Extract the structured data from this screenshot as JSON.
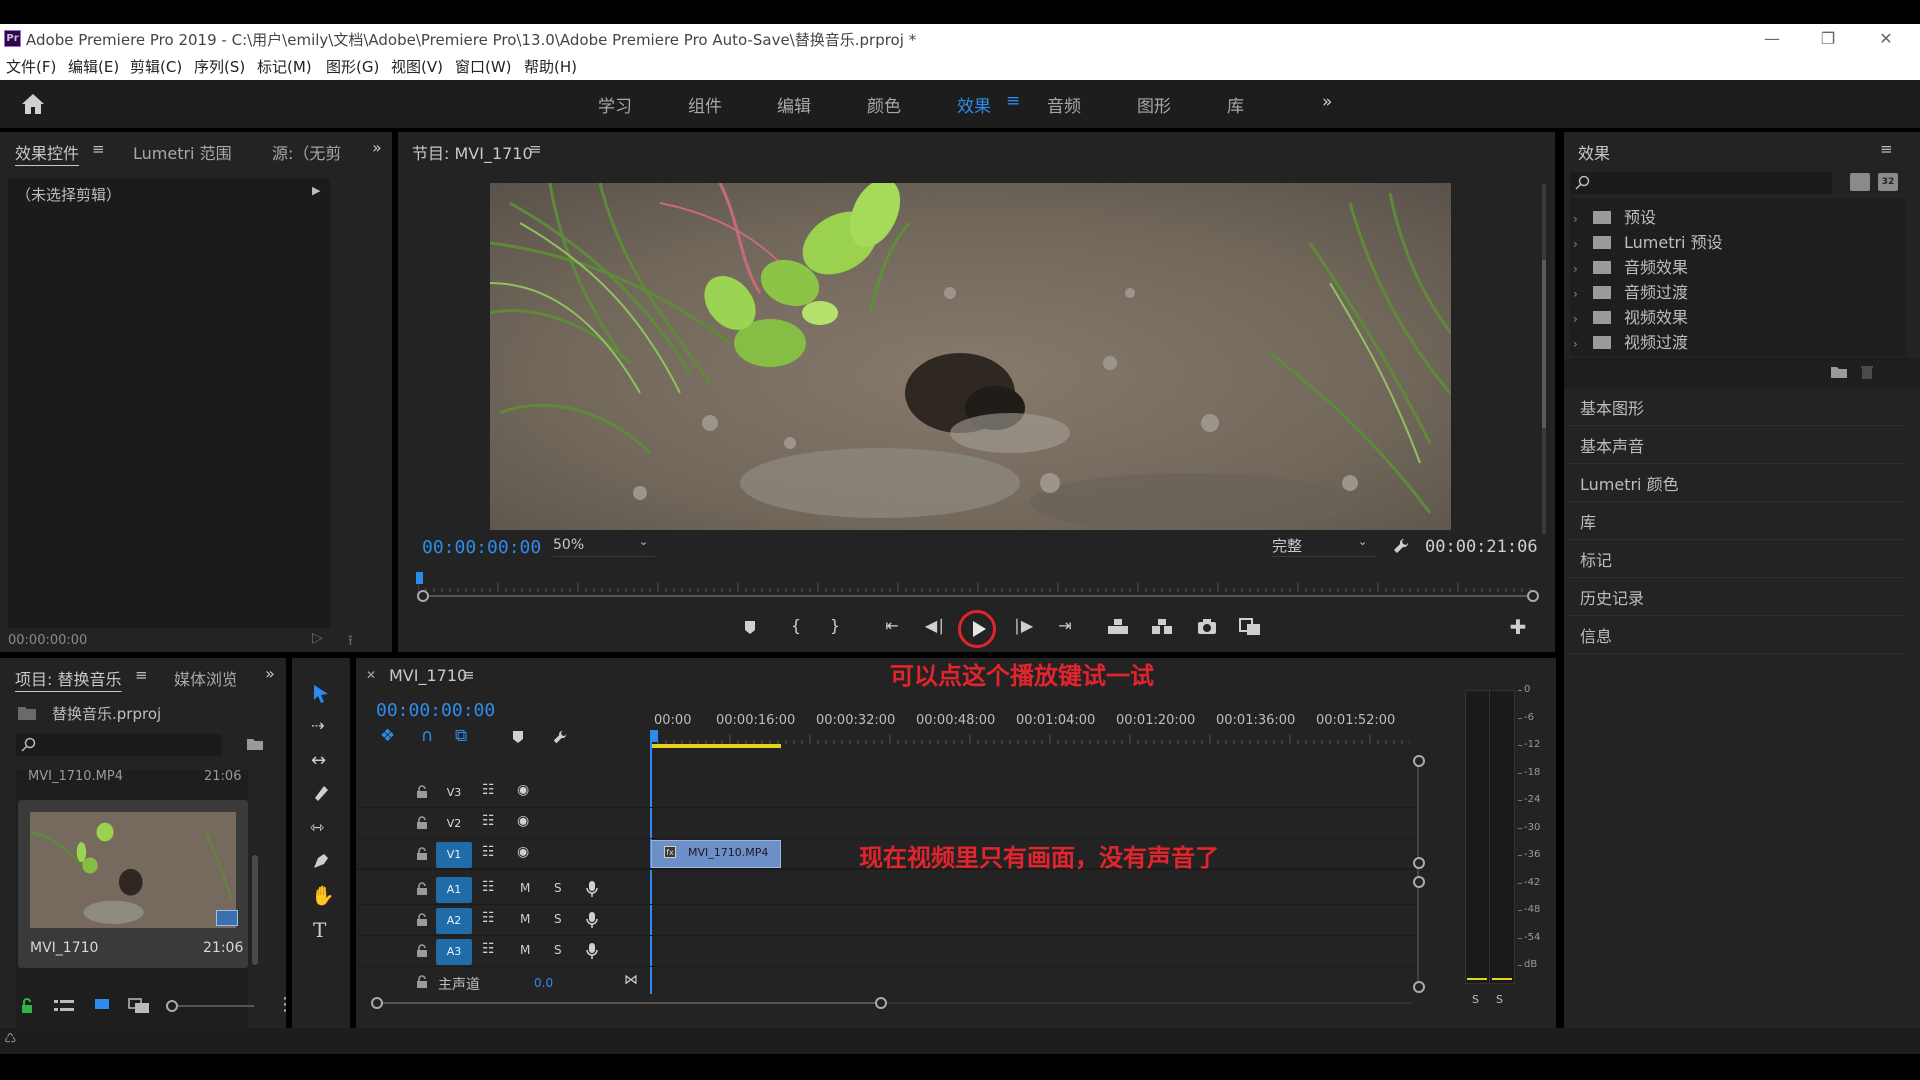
{
  "window": {
    "title": "Adobe Premiere Pro 2019 - C:\\用户\\emily\\文档\\Adobe\\Premiere Pro\\13.0\\Adobe Premiere Pro Auto-Save\\替换音乐.prproj *",
    "logo": "Pr"
  },
  "menu": [
    "文件(F)",
    "编辑(E)",
    "剪辑(C)",
    "序列(S)",
    "标记(M)",
    "图形(G)",
    "视图(V)",
    "窗口(W)",
    "帮助(H)"
  ],
  "workspaces": {
    "tabs": [
      "学习",
      "组件",
      "编辑",
      "颜色",
      "效果",
      "音频",
      "图形",
      "库"
    ],
    "active": "效果"
  },
  "effect_controls": {
    "tabs": [
      "效果控件",
      "Lumetri 范围",
      "源:（无剪"
    ],
    "no_clip": "（未选择剪辑）",
    "timecode": "00:00:00:00"
  },
  "program": {
    "title": "节目: MVI_1710",
    "timecode": "00:00:00:00",
    "zoom": "50%",
    "quality": "完整",
    "duration": "00:00:21:06"
  },
  "effects": {
    "title": "效果",
    "folders": [
      "预设",
      "Lumetri 预设",
      "音频效果",
      "音频过渡",
      "视频效果",
      "视频过渡"
    ],
    "sections": [
      "基本图形",
      "基本声音",
      "Lumetri 颜色",
      "库",
      "标记",
      "历史记录",
      "信息"
    ]
  },
  "project": {
    "tab": "项目: 替换音乐",
    "tab2": "媒体浏览",
    "file": "替换音乐.prproj",
    "clip_header_name": "MVI_1710.MP4",
    "clip_header_duration": "21:06",
    "clip_name": "MVI_1710",
    "clip_duration": "21:06"
  },
  "timeline": {
    "tab": "MVI_1710",
    "timecode": "00:00:00:00",
    "ruler": [
      "00:00",
      "00:00:16:00",
      "00:00:32:00",
      "00:00:48:00",
      "00:01:04:00",
      "00:01:20:00",
      "00:01:36:00",
      "00:01:52:00"
    ],
    "video_tracks": [
      "V3",
      "V2",
      "V1"
    ],
    "audio_tracks": [
      "A1",
      "A2",
      "A3"
    ],
    "master_label": "主声道",
    "master_value": "0.0",
    "clip_label": "MVI_1710.MP4",
    "m": "M",
    "s": "S"
  },
  "meter": {
    "scale": [
      "0",
      "-6",
      "-12",
      "-18",
      "-24",
      "-30",
      "-36",
      "-42",
      "-48",
      "-54",
      "dB"
    ],
    "solo": [
      "S",
      "S"
    ]
  },
  "annotations": {
    "play_hint": "可以点这个播放键试一试",
    "audio_hint": "现在视频里只有画面，没有声音了"
  },
  "colors": {
    "accent": "#2d8ceb",
    "annotation": "#e2242d",
    "clip": "#6d8fc8"
  }
}
